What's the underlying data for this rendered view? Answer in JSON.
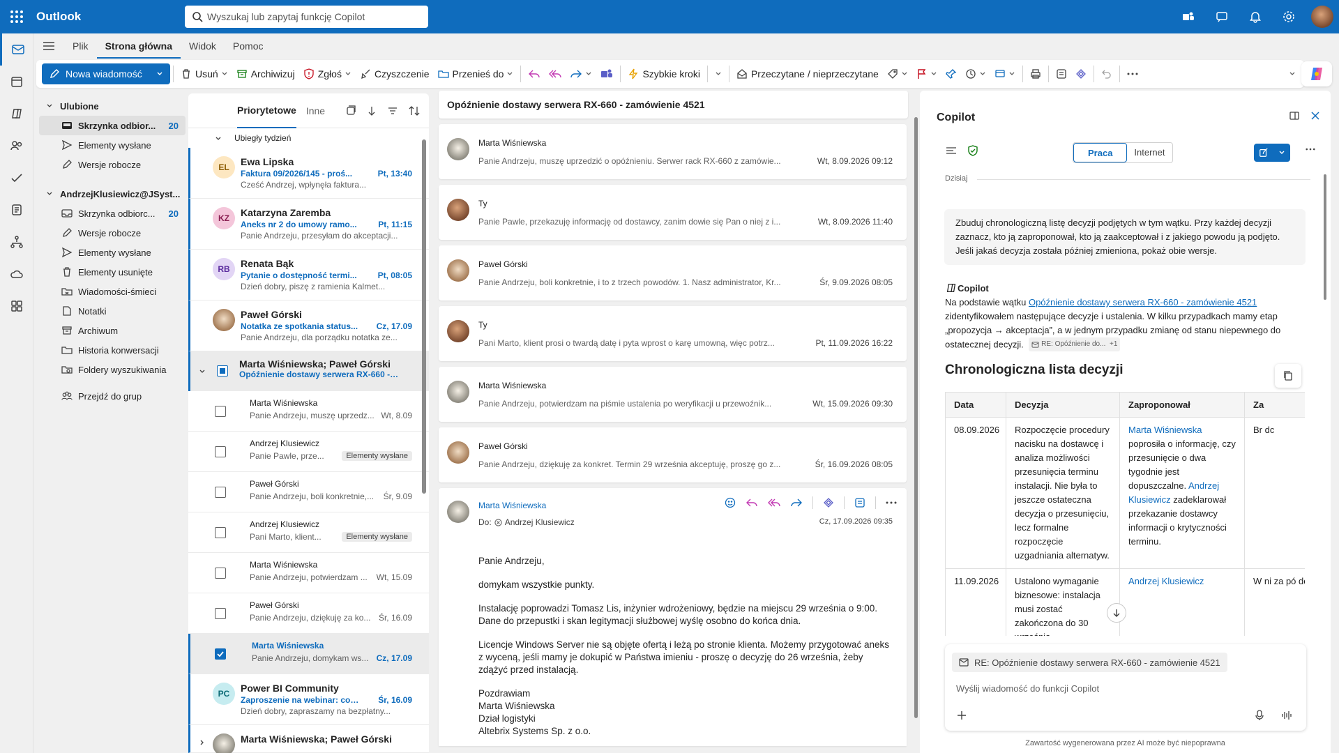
{
  "app": {
    "title": "Outlook"
  },
  "search": {
    "placeholder": "Wyszukaj lub zapytaj funkcję Copilot"
  },
  "menu": {
    "tabs": [
      "Plik",
      "Strona główna",
      "Widok",
      "Pomoc"
    ],
    "selected": "Strona główna"
  },
  "ribbon": {
    "new_mail": "Nowa wiadomość",
    "delete": "Usuń",
    "archive": "Archiwizuj",
    "report": "Zgłoś",
    "sweep": "Czyszczenie",
    "move": "Przenieś do",
    "quick_steps": "Szybkie kroki",
    "read_unread": "Przeczytane / nieprzeczytane"
  },
  "folders": {
    "favorites_title": "Ulubione",
    "favorites": [
      {
        "label": "Skrzynka odbior...",
        "count": "20",
        "selected": true
      },
      {
        "label": "Elementy wysłane",
        "count": ""
      },
      {
        "label": "Wersje robocze",
        "count": ""
      }
    ],
    "account_title": "AndrzejKlusiewicz@JSyst...",
    "account": [
      {
        "label": "Skrzynka odbiorc...",
        "count": "20"
      },
      {
        "label": "Wersje robocze",
        "count": ""
      },
      {
        "label": "Elementy wysłane",
        "count": ""
      },
      {
        "label": "Elementy usunięte",
        "count": ""
      },
      {
        "label": "Wiadomości-śmieci",
        "count": ""
      },
      {
        "label": "Notatki",
        "count": ""
      },
      {
        "label": "Archiwum",
        "count": ""
      },
      {
        "label": "Historia konwersacji",
        "count": ""
      },
      {
        "label": "Foldery wyszukiwania",
        "count": ""
      }
    ],
    "groups": "Przejdź do grup"
  },
  "mail_list": {
    "tabs": [
      "Priorytetowe",
      "Inne"
    ],
    "section": "Ubiegły tydzień",
    "messages": [
      {
        "initials": "EL",
        "color": "#fde7c1",
        "fg": "#8a5a00",
        "from": "Ewa Lipska",
        "subject": "Faktura 09/2026/145 - proś...",
        "time": "Pt, 13:40",
        "preview": "Cześć Andrzej, wpłynęła faktura..."
      },
      {
        "initials": "KZ",
        "color": "#f4c6da",
        "fg": "#8a1f52",
        "from": "Katarzyna Zaremba",
        "subject": "Aneks nr 2 do umowy ramo...",
        "time": "Pt, 11:15",
        "preview": "Panie Andrzeju, przesyłam do akceptacji..."
      },
      {
        "initials": "RB",
        "color": "#e2d5f5",
        "fg": "#5b2c9e",
        "from": "Renata Bąk",
        "subject": "Pytanie o dostępność termi...",
        "time": "Pt, 08:05",
        "preview": "Dzień dobry, piszę z ramienia Kalmet..."
      },
      {
        "initials": "",
        "color": "#c9b49c",
        "fg": "#fff",
        "from": "Paweł Górski",
        "subject": "Notatka ze spotkania status...",
        "time": "Cz, 17.09",
        "preview": "Panie Andrzeju, dla porządku notatka ze..."
      }
    ],
    "conversation": {
      "from": "Marta Wiśniewska; Paweł Górski",
      "subject": "Opóźnienie dostawy serwera RX-660 - z...",
      "items": [
        {
          "from": "Marta Wiśniewska",
          "preview": "Panie Andrzeju, muszę uprzedz...",
          "time": "Wt, 8.09",
          "tag": ""
        },
        {
          "from": "Andrzej Klusiewicz",
          "preview": "Panie Pawle, prze...",
          "time": "",
          "tag": "Elementy wysłane"
        },
        {
          "from": "Paweł Górski",
          "preview": "Panie Andrzeju, boli konkretnie,...",
          "time": "Śr, 9.09",
          "tag": ""
        },
        {
          "from": "Andrzej Klusiewicz",
          "preview": "Pani Marto, klient...",
          "time": "",
          "tag": "Elementy wysłane"
        },
        {
          "from": "Marta Wiśniewska",
          "preview": "Panie Andrzeju, potwierdzam ...",
          "time": "Wt, 15.09",
          "tag": ""
        },
        {
          "from": "Paweł Górski",
          "preview": "Panie Andrzeju, dziękuję za ko...",
          "time": "Śr, 16.09",
          "tag": ""
        },
        {
          "from": "Marta Wiśniewska",
          "preview": "Panie Andrzeju, domykam ws...",
          "time": "Cz, 17.09",
          "tag": "",
          "selected": true
        }
      ]
    },
    "after": [
      {
        "initials": "PC",
        "color": "#c6ecf0",
        "fg": "#0b6a75",
        "from": "Power BI Community",
        "subject": "Zaproszenie na webinar: co ...",
        "time": "Śr, 16.09",
        "preview": "Dzień dobry, zapraszamy na bezpłatny..."
      }
    ],
    "last": {
      "from": "Marta Wiśniewska; Paweł Górski"
    }
  },
  "reading": {
    "subject": "Opóźnienie dostawy serwera RX-660 - zamówienie 4521",
    "items": [
      {
        "from": "Marta Wiśniewska",
        "preview": "Panie Andrzeju, muszę uprzedzić o opóźnieniu. Serwer rack RX-660 z zamówie...",
        "date": "Wt, 8.09.2026 09:12",
        "av": "dog"
      },
      {
        "from": "Ty",
        "preview": "Panie Pawle, przekazuję informację od dostawcy, zanim dowie się Pan o niej z i...",
        "date": "Wt, 8.09.2026 11:40",
        "av": "me"
      },
      {
        "from": "Paweł Górski",
        "preview": "Panie Andrzeju, boli konkretnie, i to z trzech powodów. 1. Nasz administrator, Kr...",
        "date": "Śr, 9.09.2026 08:05",
        "av": "pug"
      },
      {
        "from": "Ty",
        "preview": "Pani Marto, klient prosi o twardą datę i pyta wprost o karę umowną, więc potrz...",
        "date": "Pt, 11.09.2026 16:22",
        "av": "me"
      },
      {
        "from": "Marta Wiśniewska",
        "preview": "Panie Andrzeju, potwierdzam na piśmie ustalenia po weryfikacji u przewoźnik...",
        "date": "Wt, 15.09.2026 09:30",
        "av": "dog"
      },
      {
        "from": "Paweł Górski",
        "preview": "Panie Andrzeju, dziękuję za konkret. Termin 29 września akceptuję, proszę go z...",
        "date": "Śr, 16.09.2026 08:05",
        "av": "pug"
      }
    ],
    "open": {
      "from": "Marta Wiśniewska",
      "to_label": "Do:",
      "to": "Andrzej Klusiewicz",
      "date": "Cz, 17.09.2026 09:35",
      "body": [
        "Panie Andrzeju,",
        "domykam wszystkie punkty.",
        "Instalację poprowadzi Tomasz Lis, inżynier wdrożeniowy, będzie na miejscu 29 września o 9:00. Dane do przepustki i skan legitymacji służbowej wyślę osobno do końca dnia.",
        "Licencje Windows Server nie są objęte ofertą i leżą po stronie klienta. Możemy przygotować aneks z wyceną, jeśli mamy je dokupić w Państwa imieniu - proszę o decyzję do 26 września, żeby zdążyć przed instalacją."
      ],
      "signature": [
        "Pozdrawiam",
        "Marta Wiśniewska",
        "Dział logistyki",
        "Altebrix Systems Sp. z o.o."
      ]
    }
  },
  "copilot": {
    "title": "Copilot",
    "seg_work": "Praca",
    "seg_web": "Internet",
    "today": "Dzisiaj",
    "prompt": "Zbuduj chronologiczną listę decyzji podjętych w tym wątku. Przy każdej decyzji zaznacz, kto ją zaproponował, kto ją zaakceptował i z jakiego powodu ją podjęto. Jeśli jakaś decyzja została później zmieniona, pokaż obie wersje.",
    "resp_name": "Copilot",
    "resp_intro": "Na podstawie wątku ",
    "resp_link": "Opóźnienie dostawy serwera RX-660 - zamówienie 4521",
    "resp_rest": " zidentyfikowałem następujące decyzje i ustalenia. W kilku przypadkach mamy etap „propozycja → akceptacja”, a w jednym przypadku zmianę od stanu niepewnego do ostatecznej decyzji.",
    "resp_chip": "RE: Opóźnienie do...",
    "resp_chip_more": "+1",
    "heading": "Chronologiczna lista decyzji",
    "table": {
      "headers": [
        "Data",
        "Decyzja",
        "Zaproponował",
        "Za"
      ],
      "rows": [
        {
          "date": "08.09.2026",
          "decision": "Rozpoczęcie procedury nacisku na dostawcę i analiza możliwości przesunięcia terminu instalacji. Nie była to jeszcze ostateczna decyzja o przesunięciu, lecz formalne rozpoczęcie uzgadniania alternatyw.",
          "who1": "Marta Wiśniewska",
          "who_text": " poprosiła o informację, czy przesunięcie o dwa tygodnie jest dopuszczalne. ",
          "who2": "Andrzej Klusiewicz",
          "who_text2": " zadeklarował przekazanie dostawcy informacji o krytyczności terminu.",
          "acc": "Br dc"
        },
        {
          "date": "11.09.2026",
          "decision": "Ustalono wymaganie biznesowe: instalacja musi zostać zakończona do 30 września.",
          "who1": "Andrzej Klusiewicz",
          "who_text": "",
          "who2": "",
          "who_text2": "",
          "acc": "W ni za pó dc wa"
        }
      ]
    },
    "ctx": "RE: Opóźnienie dostawy serwera RX-660 - zamówienie 4521",
    "input_placeholder": "Wyślij wiadomość do funkcji Copilot",
    "footer": "Zawartość wygenerowana przez AI może być niepoprawna"
  }
}
